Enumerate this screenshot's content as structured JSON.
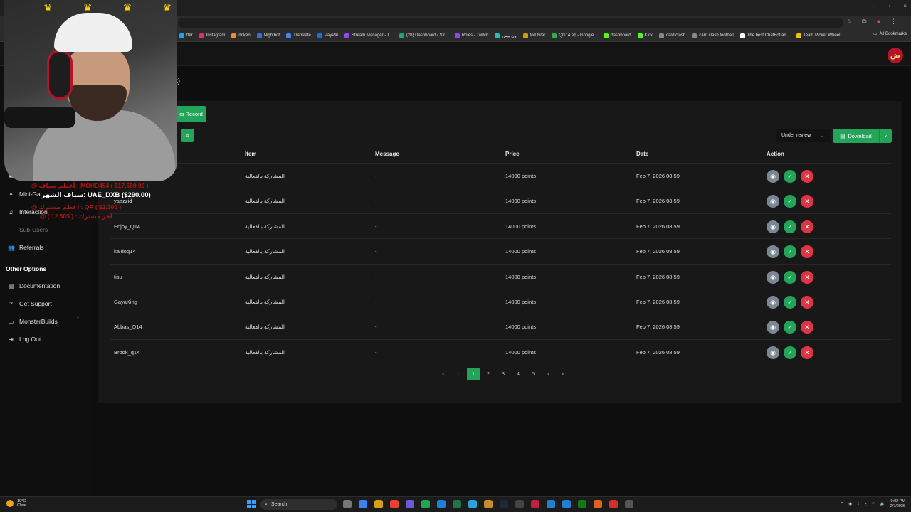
{
  "browser": {
    "window_controls": [
      "–",
      "▫",
      "×"
    ],
    "bookmarks": [
      {
        "label": "tter",
        "color": "#1da1f2"
      },
      {
        "label": "Instagram",
        "color": "#e1306c"
      },
      {
        "label": "doken",
        "color": "#f28c28"
      },
      {
        "label": "Nightbot",
        "color": "#3b6fd8"
      },
      {
        "label": "Translate",
        "color": "#4285f4"
      },
      {
        "label": "PayPal",
        "color": "#1f6fd1"
      },
      {
        "label": "Stream Manager - T...",
        "color": "#9146ff"
      },
      {
        "label": "(28) Dashboard / Str...",
        "color": "#1fa37a"
      },
      {
        "label": "Roles - Twitch",
        "color": "#9146ff"
      },
      {
        "label": "ون بيس",
        "color": "#22bdbd"
      },
      {
        "label": "tod.tv/ar",
        "color": "#c9a300"
      },
      {
        "label": "QG14 ep - Google...",
        "color": "#34a853"
      },
      {
        "label": "dashboard",
        "color": "#53fc18"
      },
      {
        "label": "Kick",
        "color": "#53fc18"
      },
      {
        "label": "card clash",
        "color": "#888888"
      },
      {
        "label": "card clash football",
        "color": "#888888"
      },
      {
        "label": "The best ChatBot an...",
        "color": "#ffffff"
      },
      {
        "label": "Team Picker Wheel...",
        "color": "#f2c200"
      }
    ],
    "all_bookmarks": "All Bookmarks"
  },
  "header": {
    "page_title_fragment": "t)"
  },
  "sidebar": {
    "items": [
      {
        "label": "Mini-Ga",
        "icon": "gamepad-icon",
        "muted": false
      },
      {
        "label": "Interaction",
        "icon": "music-icon",
        "muted": false
      },
      {
        "label": "Sub-Users",
        "icon": "users-icon",
        "muted": true
      },
      {
        "label": "Referrals",
        "icon": "users-icon",
        "muted": false
      }
    ],
    "other_heading": "Other Options",
    "other_items": [
      {
        "label": "Documentation",
        "icon": "book-icon"
      },
      {
        "label": "Get Support",
        "icon": "help-icon"
      },
      {
        "label": "MonsterBuilds",
        "icon": "laptop-icon"
      },
      {
        "label": "Log Out",
        "icon": "logout-icon"
      }
    ]
  },
  "toolbar": {
    "tab_label": "rs Record",
    "status_filter": "Under review",
    "download_label": "Download"
  },
  "table": {
    "columns": [
      "Item",
      "Message",
      "Price",
      "Date",
      "Action"
    ],
    "rows": [
      {
        "user": "",
        "item": "المشاركة بالفعالية",
        "message": "-",
        "price": "14000 points",
        "date": "Feb 7, 2026 08:59"
      },
      {
        "user": "yaazzid",
        "item": "المشاركة بالفعالية",
        "message": "-",
        "price": "14000 points",
        "date": "Feb 7, 2026 08:59"
      },
      {
        "user": "Enjoy_Q14",
        "item": "المشاركة بالفعالية",
        "message": "-",
        "price": "14000 points",
        "date": "Feb 7, 2026 08:59"
      },
      {
        "user": "kaidoq14",
        "item": "المشاركة بالفعالية",
        "message": "-",
        "price": "14000 points",
        "date": "Feb 7, 2026 08:59"
      },
      {
        "user": "tisu",
        "item": "المشاركة بالفعالية",
        "message": "-",
        "price": "14000 points",
        "date": "Feb 7, 2026 08:59"
      },
      {
        "user": "GayaKing",
        "item": "المشاركة بالفعالية",
        "message": "-",
        "price": "14000 points",
        "date": "Feb 7, 2026 08:59"
      },
      {
        "user": "Abbas_Q14",
        "item": "المشاركة بالفعالية",
        "message": "-",
        "price": "14000 points",
        "date": "Feb 7, 2026 08:59"
      },
      {
        "user": "Brook_q14",
        "item": "المشاركة بالفعالية",
        "message": "-",
        "price": "14000 points",
        "date": "Feb 7, 2026 08:59"
      }
    ]
  },
  "pagination": {
    "first": "«",
    "prev": "‹",
    "pages": [
      "1",
      "2",
      "3",
      "4",
      "5"
    ],
    "active": "1",
    "next": "›",
    "last": "»"
  },
  "stream_overlay": {
    "line1": "@ أعظم سياف : MOHD454 ( $17,580.00 )",
    "line2": "سياف الشهر: UAE_DXB ($290.00)",
    "line3": "@ أعظم مشترك : QR ( $2,300 )",
    "line4": "@ آخر مشترك : ( $12.50 )"
  },
  "taskbar": {
    "temp": "19°C",
    "weather": "Clear",
    "search_label": "Search",
    "time": "9:02 PM",
    "date": "2/7/2026",
    "lang": "ع"
  }
}
